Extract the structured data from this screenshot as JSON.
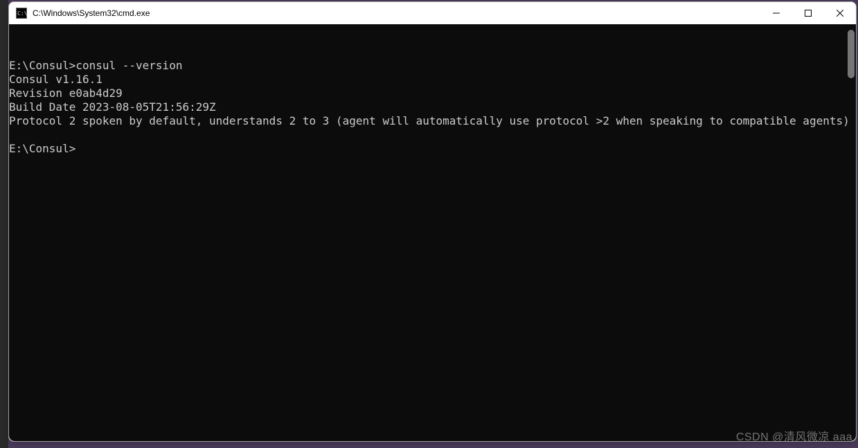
{
  "titlebar": {
    "icon_label": "C:\\",
    "title": "C:\\Windows\\System32\\cmd.exe"
  },
  "terminal": {
    "prompt1": "E:\\Consul>",
    "command1": "consul --version",
    "line_version": "Consul v1.16.1",
    "line_revision": "Revision e0ab4d29",
    "line_builddate": "Build Date 2023-08-05T21:56:29Z",
    "line_protocol": "Protocol 2 spoken by default, understands 2 to 3 (agent will automatically use protocol >2 when speaking to compatible agents)",
    "prompt2": "E:\\Consul>"
  },
  "watermark": "CSDN @清风微凉 aaa"
}
